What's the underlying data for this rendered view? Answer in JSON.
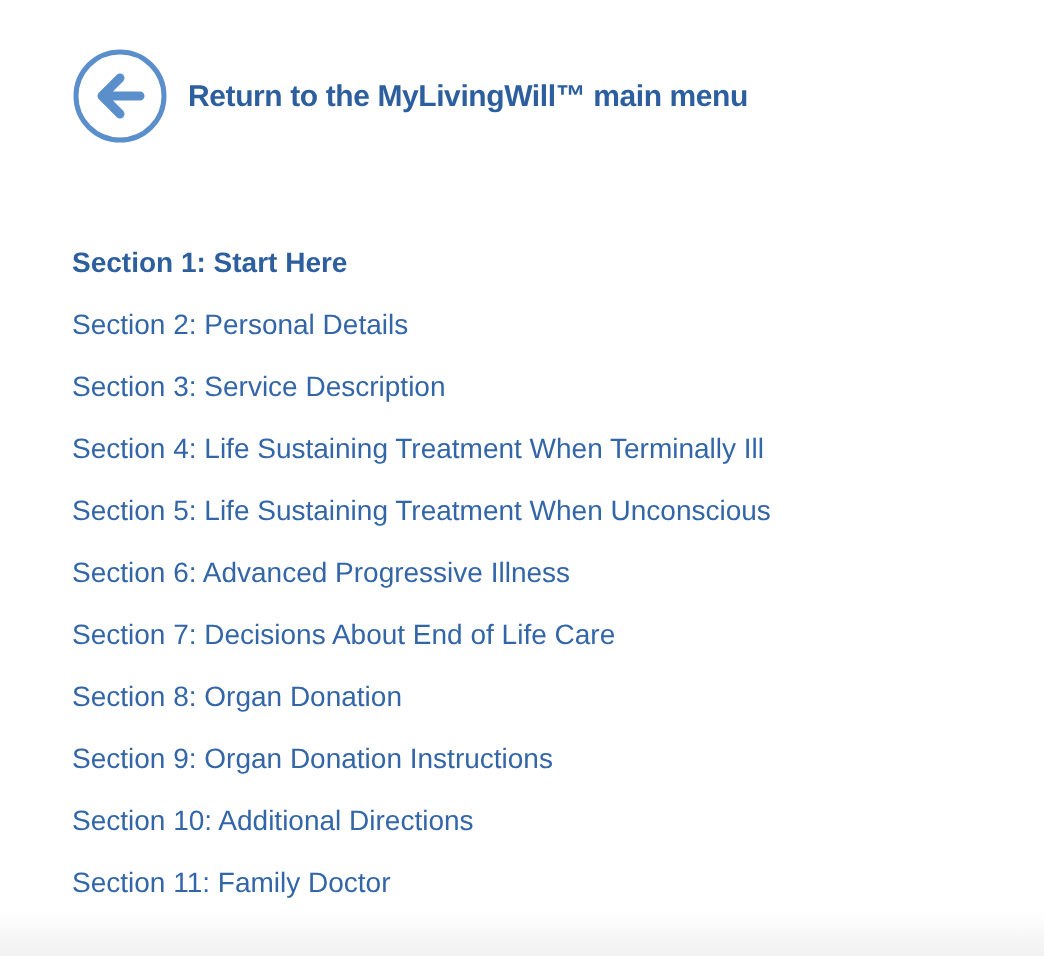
{
  "back_link": {
    "label": "Return to the MyLivingWill™ main menu"
  },
  "sections": [
    {
      "label": "Section 1: Start Here",
      "selected": true
    },
    {
      "label": "Section 2: Personal Details",
      "selected": false
    },
    {
      "label": "Section 3: Service Description",
      "selected": false
    },
    {
      "label": "Section 4: Life Sustaining Treatment When Terminally Ill",
      "selected": false
    },
    {
      "label": "Section 5: Life Sustaining Treatment When Unconscious",
      "selected": false
    },
    {
      "label": "Section 6: Advanced Progressive Illness",
      "selected": false
    },
    {
      "label": "Section 7: Decisions About End of Life Care",
      "selected": false
    },
    {
      "label": "Section 8: Organ Donation",
      "selected": false
    },
    {
      "label": "Section 9: Organ Donation Instructions",
      "selected": false
    },
    {
      "label": "Section 10: Additional Directions",
      "selected": false
    },
    {
      "label": "Section 11: Family Doctor",
      "selected": false
    }
  ]
}
